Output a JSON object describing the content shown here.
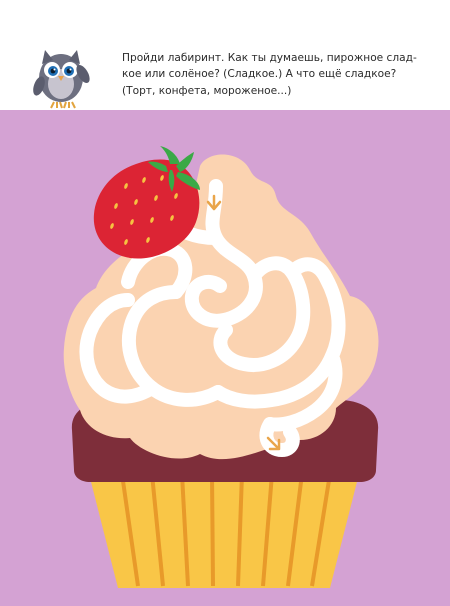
{
  "instruction": {
    "line1": "Пройди лабиринт. Как ты думаешь, пирожное слад-",
    "line2": "кое или солёное? (Сладкое.) А что ещё сладкое?",
    "line3": "(Торт, конфета, мороженое...)"
  },
  "icons": {
    "owl": "owl-icon",
    "start": "arrow-down-icon",
    "finish": "arrow-down-right-icon"
  },
  "colors": {
    "background": "#d4a2d3",
    "cream": "#fbd3b1",
    "maze_path": "#ffffff",
    "cake": "#7e2e3a",
    "cup": "#f9c647",
    "strawberry": "#dc2434",
    "leaves": "#3aa946"
  }
}
